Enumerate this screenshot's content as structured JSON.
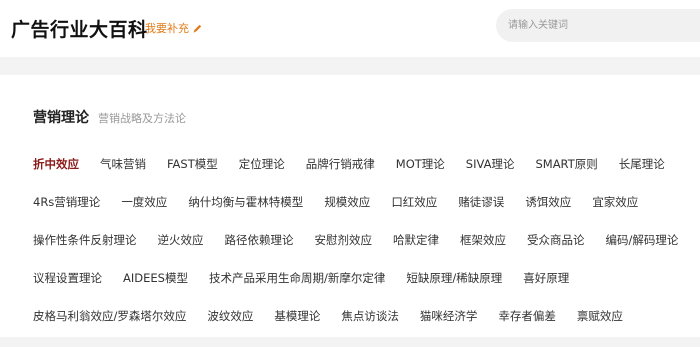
{
  "header": {
    "site_title": "广告行业大百科",
    "supplement_label": "我要补充",
    "supplement_icon": "pencil-icon",
    "search_placeholder": "请输入关键词",
    "accent_color": "#e07c1b"
  },
  "section": {
    "title": "营销理论",
    "subtitle": "营销战略及方法论",
    "active_color": "#8b1a1a"
  },
  "tags": [
    [
      "折中效应",
      "气味营销",
      "FAST模型",
      "定位理论",
      "品牌行销戒律",
      "MOT理论",
      "SIVA理论",
      "SMART原则",
      "长尾理论"
    ],
    [
      "4Rs营销理论",
      "一度效应",
      "纳什均衡与霍林特模型",
      "规模效应",
      "口红效应",
      "赌徒谬误",
      "诱饵效应",
      "宜家效应"
    ],
    [
      "操作性条件反射理论",
      "逆火效应",
      "路径依赖理论",
      "安慰剂效应",
      "哈默定律",
      "框架效应",
      "受众商品论",
      "编码/解码理论"
    ],
    [
      "议程设置理论",
      "AIDEES模型",
      "技术产品采用生命周期/新摩尔定律",
      "短缺原理/稀缺原理",
      "喜好原理"
    ],
    [
      "皮格马利翁效应/罗森塔尔效应",
      "波纹效应",
      "基模理论",
      "焦点访谈法",
      "猫咪经济学",
      "幸存者偏差",
      "禀赋效应"
    ]
  ],
  "active_tag": "折中效应"
}
